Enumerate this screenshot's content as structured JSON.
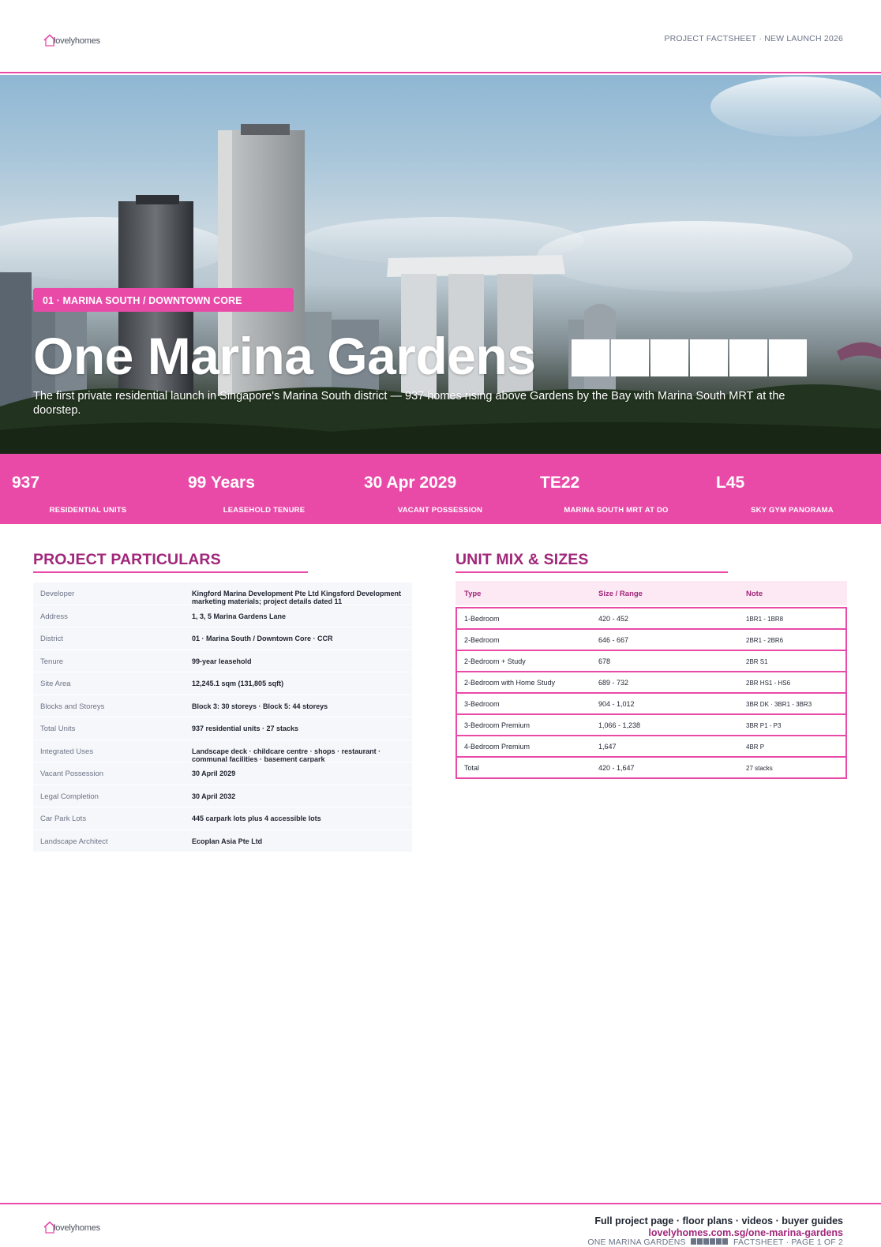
{
  "brand": {
    "logo_text": "lovelyhomes",
    "accent": "#e94aa8",
    "accent_dark": "#a0277a"
  },
  "header": {
    "tag": "PROJECT FACTSHEET · NEW LAUNCH 2026"
  },
  "hero": {
    "badge": "01 · MARINA SOUTH / DOWNTOWN CORE",
    "title": "One Marina Gardens",
    "subtitle": "The first private residential launch in Singapore's Marina South district — 937 homes rising above Gardens by the Bay with Marina South MRT at the doorstep."
  },
  "stats": [
    {
      "value": "937",
      "label": "RESIDENTIAL UNITS"
    },
    {
      "value": "99 Years",
      "label": "LEASEHOLD TENURE"
    },
    {
      "value": "30 Apr 2029",
      "label": "VACANT POSSESSION"
    },
    {
      "value": "TE22",
      "label": "MARINA SOUTH MRT AT DO"
    },
    {
      "value": "L45",
      "label": "SKY GYM PANORAMA"
    }
  ],
  "particulars": {
    "title": "PROJECT PARTICULARS",
    "rows": [
      {
        "label": "Developer",
        "value": "Kingford Marina Development Pte Ltd Kingsford Development marketing materials; project details dated 11"
      },
      {
        "label": "Address",
        "value": "1, 3, 5 Marina Gardens Lane"
      },
      {
        "label": "District",
        "value": "01 · Marina South / Downtown Core · CCR"
      },
      {
        "label": "Tenure",
        "value": "99-year leasehold"
      },
      {
        "label": "Site Area",
        "value": "12,245.1 sqm (131,805 sqft)"
      },
      {
        "label": "Blocks and Storeys",
        "value": "Block 3: 30 storeys · Block 5: 44 storeys"
      },
      {
        "label": "Total Units",
        "value": "937 residential units · 27 stacks"
      },
      {
        "label": "Integrated Uses",
        "value": "Landscape deck · childcare centre · shops · restaurant · communal facilities · basement carpark"
      },
      {
        "label": "Vacant Possession",
        "value": "30 April 2029"
      },
      {
        "label": "Legal Completion",
        "value": "30 April 2032"
      },
      {
        "label": "Car Park Lots",
        "value": "445 carpark lots plus 4 accessible lots"
      },
      {
        "label": "Landscape Architect",
        "value": "Ecoplan Asia Pte Ltd"
      }
    ]
  },
  "unit_mix": {
    "title": "UNIT MIX & SIZES",
    "headers": {
      "type": "Type",
      "size": "Size / Range",
      "note": "Note"
    },
    "rows": [
      {
        "type": "1-Bedroom",
        "size": "420 - 452",
        "note": "1BR1 - 1BR8"
      },
      {
        "type": "2-Bedroom",
        "size": "646 - 667",
        "note": "2BR1 - 2BR6"
      },
      {
        "type": "2-Bedroom + Study",
        "size": "678",
        "note": "2BR S1"
      },
      {
        "type": "2-Bedroom with Home Study",
        "size": "689 - 732",
        "note": "2BR HS1 - HS6"
      },
      {
        "type": "3-Bedroom",
        "size": "904 - 1,012",
        "note": "3BR DK · 3BR1 - 3BR3"
      },
      {
        "type": "3-Bedroom Premium",
        "size": "1,066 - 1,238",
        "note": "3BR P1 - P3"
      },
      {
        "type": "4-Bedroom Premium",
        "size": "1,647",
        "note": "4BR P"
      },
      {
        "type": "Total",
        "size": "420 - 1,647",
        "note": "27 stacks"
      }
    ]
  },
  "footer": {
    "line1": "Full project page · floor plans · videos · buyer guides",
    "line2": "lovelyhomes.com.sg/one-marina-gardens",
    "line3_prefix": "ONE MARINA GARDENS",
    "line3_suffix": "FACTSHEET · PAGE 1 OF 2"
  }
}
